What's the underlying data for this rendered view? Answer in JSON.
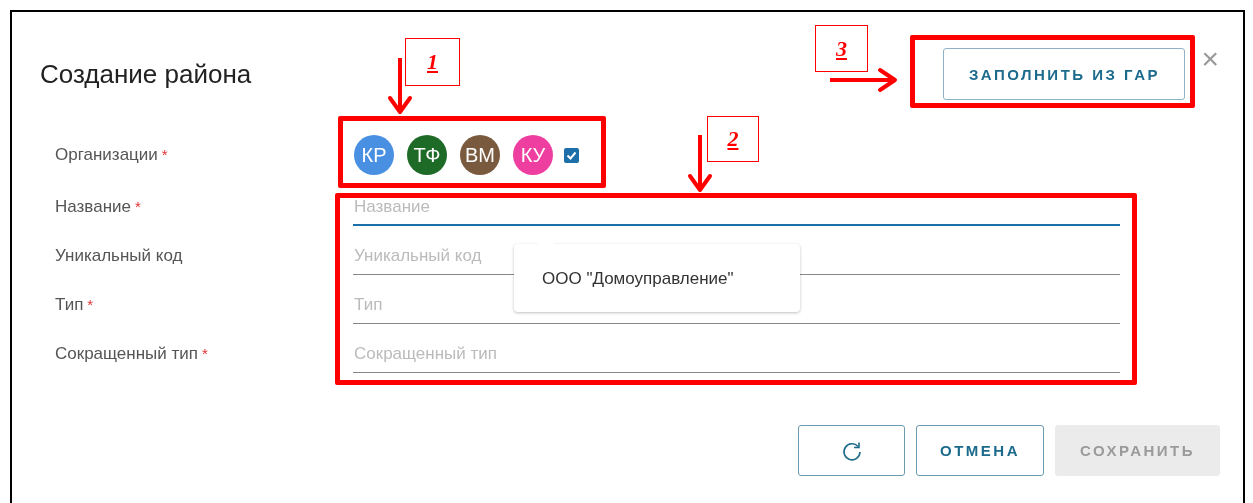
{
  "dialog": {
    "title": "Создание района",
    "fill_button": "ЗАПОЛНИТЬ ИЗ ГАР",
    "close": "×"
  },
  "organizations": {
    "label": "Организации",
    "required_mark": "*",
    "checked": true,
    "avatars": [
      {
        "initials": "КР",
        "color": "#4a90e2"
      },
      {
        "initials": "ТФ",
        "color": "#1e6b28"
      },
      {
        "initials": "ВМ",
        "color": "#7a5a3e"
      },
      {
        "initials": "КУ",
        "color": "#ee3ea0"
      }
    ]
  },
  "fields": [
    {
      "label": "Название",
      "required_mark": "*",
      "placeholder": "Название",
      "focused": true
    },
    {
      "label": "Уникальный код",
      "placeholder": "Уникальный код",
      "focused": false
    },
    {
      "label": "Тип",
      "required_mark": "*",
      "placeholder": "Тип",
      "focused": false
    },
    {
      "label": "Сокращенный тип",
      "required_mark": "*",
      "placeholder": "Сокращенный тип",
      "focused": false
    }
  ],
  "tooltip": "ООО \"Домоуправление\"",
  "buttons": [
    {
      "kind": "icon",
      "disabled": false
    },
    {
      "kind": "text",
      "label": "ОТМЕНА",
      "disabled": false
    },
    {
      "kind": "text",
      "label": "СОХРАНИТЬ",
      "disabled": true
    }
  ],
  "annotations": [
    {
      "label": "1"
    },
    {
      "label": "2"
    },
    {
      "label": "3"
    }
  ]
}
